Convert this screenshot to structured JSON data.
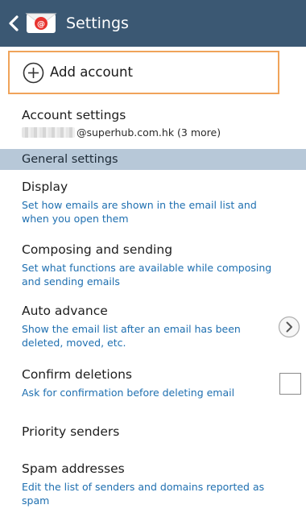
{
  "action_bar": {
    "title": "Settings",
    "background": "#3b5873",
    "back_icon": "chevron-left-icon",
    "app_icon": "email-app-icon"
  },
  "add_account": {
    "label": "Add account",
    "icon": "plus-circle-icon",
    "highlight_color": "#f0a35a"
  },
  "account_settings": {
    "title": "Account settings",
    "account_suffix": "@superhub.com.hk (3 more)"
  },
  "section": {
    "label": "General settings",
    "background": "#b7c8d8"
  },
  "settings": [
    {
      "title": "Display",
      "subtitle": "Set how emails are shown in the email list and when you open them"
    },
    {
      "title": "Composing and sending",
      "subtitle": "Set what functions are available while composing and sending emails"
    },
    {
      "title": "Auto advance",
      "subtitle": "Show the email list after an email has been deleted, moved, etc.",
      "control": "chevron-right-icon"
    },
    {
      "title": "Confirm deletions",
      "subtitle": "Ask for confirmation before deleting email",
      "control": "checkbox",
      "checked": false
    },
    {
      "title": "Priority senders"
    },
    {
      "title": "Spam addresses",
      "subtitle": "Edit the list of senders and domains reported as spam"
    }
  ],
  "colors": {
    "subtitle_blue": "#1e6fb0",
    "title_text": "#1d1d1d"
  }
}
